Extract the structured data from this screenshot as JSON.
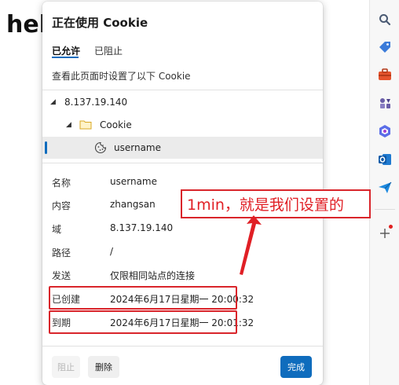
{
  "page": {
    "heading": "hel"
  },
  "dialog": {
    "title": "正在使用 Cookie",
    "tabs": [
      {
        "label": "已允许",
        "active": true
      },
      {
        "label": "已阻止",
        "active": false
      }
    ],
    "description": "查看此页面时设置了以下 Cookie",
    "tree": {
      "site": "8.137.19.140",
      "folder": "Cookie",
      "cookie": "username"
    },
    "details": [
      {
        "label": "名称",
        "value": "username"
      },
      {
        "label": "内容",
        "value": "zhangsan"
      },
      {
        "label": "域",
        "value": "8.137.19.140"
      },
      {
        "label": "路径",
        "value": "/"
      },
      {
        "label": "发送",
        "value": "仅限相同站点的连接"
      },
      {
        "label": "已创建",
        "value": "2024年6月17日星期一 20:00:32"
      },
      {
        "label": "到期",
        "value": "2024年6月17日星期一 20:01:32"
      }
    ],
    "buttons": {
      "block": "阻止",
      "delete": "删除",
      "done": "完成"
    }
  },
  "annotation": {
    "text": "1min，就是我们设置的",
    "color": "#e01f25"
  },
  "sidebar": {
    "icons": [
      "search-icon",
      "tag-icon",
      "toolbox-icon",
      "games-icon",
      "copilot-icon",
      "outlook-icon",
      "send-icon",
      "add-icon"
    ]
  },
  "colors": {
    "accent": "#0f6cbd",
    "highlight": "#d9252b"
  }
}
